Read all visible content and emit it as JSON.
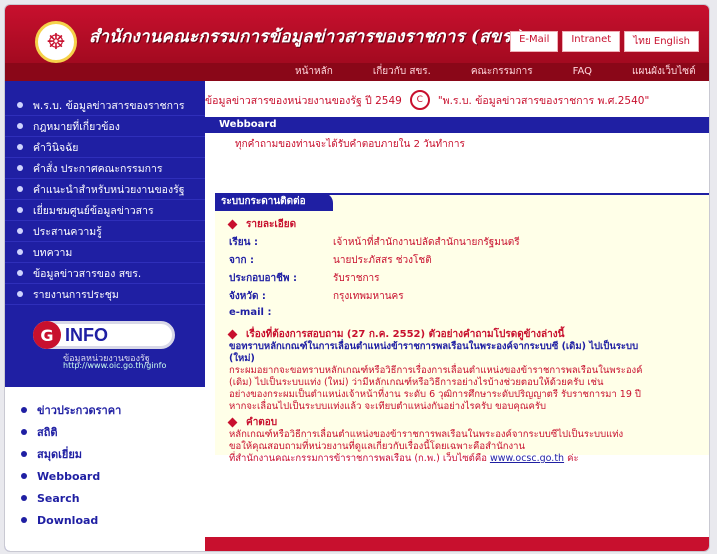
{
  "header": {
    "site_title": "สำนักงานคณะกรรมการข้อมูลข่าวสารของราชการ (สขร.)",
    "toplinks": [
      "E-Mail",
      "Intranet",
      "ไทย  English"
    ]
  },
  "menu": [
    "หน้าหลัก",
    "เกี่ยวกับ สขร.",
    "คณะกรรมการ",
    "FAQ",
    "แผนผังเว็บไซต์"
  ],
  "sidebar": {
    "items": [
      "พ.ร.บ. ข้อมูลข่าวสารของราชการ",
      "กฎหมายที่เกี่ยวข้อง",
      "คำวินิจฉัย",
      "คำสั่ง ประกาศคณะกรรมการ",
      "คำแนะนำสำหรับหน่วยงานของรัฐ",
      "เยี่ยมชมศูนย์ข้อมูลข่าวสาร",
      "ประสานความรู้",
      "บทความ",
      "ข้อมูลข่าวสารของ สขร.",
      "รายงานการประชุม"
    ],
    "ginfo": {
      "g": "G",
      "label": "INFO",
      "subtitle": "ข้อมูลหน่วยงานของรัฐ",
      "url": "http://www.oic.go.th/ginfo"
    },
    "links": [
      "ข่าวประกวดราคา",
      "สถิติ",
      "สมุดเยี่ยม",
      "Webboard",
      "Search",
      "Download"
    ]
  },
  "main": {
    "info_text": "ข้อมูลข่าวสารของหน่วยงานของรัฐ ปี 2549",
    "info_icon_label": "C",
    "info_text_2": "\"พ.ร.บ. ข้อมูลข่าวสารของราชการ พ.ศ.2540\"",
    "webboard_label": "Webboard",
    "answer_note": "ทุกคำถามของท่านจะได้รับคำตอบภายใน 2 วันทำการ",
    "contact": {
      "title": "ระบบกระดานติดต่อ",
      "section1": "รายละเอียด",
      "fields": [
        {
          "label": "เรียน :",
          "value": "เจ้าหน้าที่สำนักงานปลัดสำนักนายกรัฐมนตรี"
        },
        {
          "label": "จาก :",
          "value": "นายประภัสสร ช่วงโชติ"
        },
        {
          "label": "ประกอบอาชีพ :",
          "value": "รับราชการ"
        },
        {
          "label": "จังหวัด :",
          "value": "กรุงเทพมหานคร"
        },
        {
          "label": "e-mail :",
          "value": ""
        }
      ],
      "question_head": "เรื่องที่ต้องการสอบถาม (27 ก.ค. 2552) ตัวอย่างคำถามโปรดดูข้างล่างนี้",
      "question_bold": "ขอทราบหลักเกณฑ์ในการเลื่อนตำแหน่งข้าราชการพลเรือนในพระองค์จากระบบซี (เดิม) ไปเป็นระบบ",
      "question_bold_2": "(ใหม่)",
      "question_lines": [
        "กระผมอยากจะขอทราบหลักเกณฑ์หรือวิธีการเรื่องการเลื่อนตำแหน่งของข้าราชการพลเรือนในพระองค์",
        "(เดิม) ไปเป็นระบบแท่ง (ใหม่) ว่ามีหลักเกณฑ์หรือวิธีการอย่างไรบ้างช่วยตอบให้ด้วยครับ เช่น",
        "อย่างของกระผมเป็นตำแหน่งเจ้าหน้าที่งาน ระดับ 6 วุฒิการศึกษาระดับปริญญาตรี รับราชการมา 19 ปี",
        "หากจะเลื่อนไปเป็นระบบแท่งแล้ว จะเทียบตำแหน่งกันอย่างไรครับ ขอบคุณครับ"
      ],
      "answer_head": "คำตอบ",
      "answer_lines": [
        "หลักเกณฑ์หรือวิธีการเลื่อนตำแหน่งของข้าราชการพลเรือนในพระองค์จากระบบซีไปเป็นระบบแท่ง",
        "ขอให้คุณสอบถามที่หน่วยงานที่ดูแลเกี่ยวกับเรื่องนี้โดยเฉพาะคือสำนักงาน",
        "ที่สำนักงานคณะกรรมการข้าราชการพลเรือน (ก.พ.) เว็บไซต์คือ"
      ],
      "answer_link": "www.ocsc.go.th",
      "answer_tail": "ค่ะ"
    }
  },
  "colors": {
    "brand_red": "#c8102e",
    "nav_blue": "#1f1fa3"
  }
}
